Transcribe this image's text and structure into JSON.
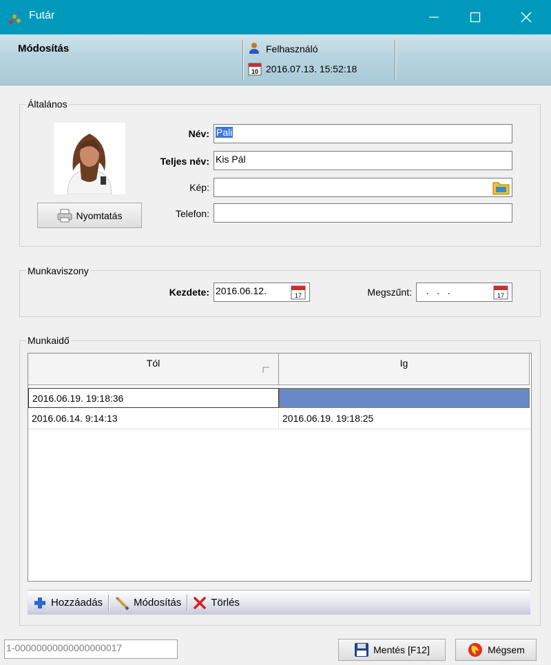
{
  "window": {
    "title": "Futár"
  },
  "header": {
    "title": "Módosítás",
    "user": "Felhasználó",
    "datetime": "2016.07.13. 15:52:18",
    "calendar_day": "10"
  },
  "general": {
    "group_title": "Általános",
    "print_label": "Nyomtatás",
    "name_label": "Név:",
    "name_value": "Pali",
    "fullname_label": "Teljes név:",
    "fullname_value": "Kis Pál",
    "image_label": "Kép:",
    "image_value": "",
    "phone_label": "Telefon:",
    "phone_value": ""
  },
  "employment": {
    "group_title": "Munkaviszony",
    "start_label": "Kezdete:",
    "start_value": "2016.06.12.",
    "end_label": "Megszűnt:",
    "end_value": "   .   .   .",
    "calendar_day": "17"
  },
  "worktime": {
    "group_title": "Munkaidő",
    "columns": [
      "Tól",
      "Ig"
    ],
    "rows": [
      {
        "from": "2016.06.19. 19:18:36",
        "to": ""
      },
      {
        "from": "2016.06.14. 9:14:13",
        "to": "2016.06.19. 19:18:25"
      }
    ],
    "toolbar": {
      "add": "Hozzáadás",
      "edit": "Módosítás",
      "delete": "Törlés"
    }
  },
  "footer": {
    "record_id": "1-00000000000000000017",
    "save_label": "Mentés [F12]",
    "cancel_label": "Mégsem"
  },
  "colors": {
    "titlebar": "#0099bc",
    "selection": "#3a78d6",
    "selected_cell": "#6689c6"
  }
}
